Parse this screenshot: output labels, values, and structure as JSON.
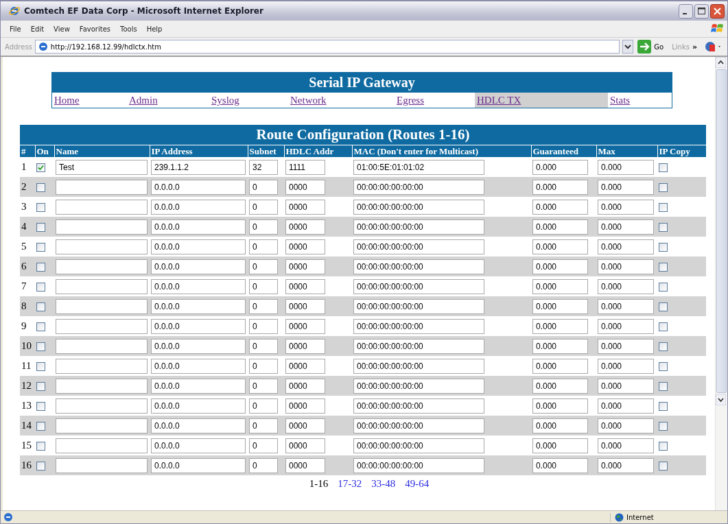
{
  "window": {
    "title": "Comtech EF Data Corp - Microsoft Internet Explorer"
  },
  "menu": [
    "File",
    "Edit",
    "View",
    "Favorites",
    "Tools",
    "Help"
  ],
  "address_bar": {
    "label": "Address",
    "value": "http://192.168.12.99/hdlctx.htm",
    "go": "Go",
    "links": "Links",
    "more": "»"
  },
  "nav": {
    "title": "Serial IP Gateway",
    "links": [
      {
        "label": "Home",
        "selected": false
      },
      {
        "label": "Admin",
        "selected": false
      },
      {
        "label": "Syslog",
        "selected": false
      },
      {
        "label": "Network",
        "selected": false
      },
      {
        "label": "Egress",
        "selected": false
      },
      {
        "label": "HDLC TX",
        "selected": true
      },
      {
        "label": "Stats",
        "selected": false
      }
    ]
  },
  "table": {
    "title": "Route Configuration (Routes 1-16)",
    "columns": [
      "#",
      "On",
      "Name",
      "IP Address",
      "Subnet",
      "HDLC Addr",
      "MAC (Don't enter for Multicast)",
      "Guaranteed",
      "Max",
      "IP Copy"
    ],
    "rows": [
      {
        "number": "1",
        "on": true,
        "name": "Test",
        "ip": "239.1.1.2",
        "subnet": "32",
        "hdlc": "1111",
        "mac": "01:00:5E:01:01:02",
        "guaranteed": "0.000",
        "max": "0.000",
        "ip_copy": false
      },
      {
        "number": "2",
        "on": false,
        "ip": "0.0.0.0",
        "subnet": "0",
        "hdlc": "0000",
        "mac": "00:00:00:00:00:00",
        "guaranteed": "0.000",
        "max": "0.000",
        "ip_copy": false
      },
      {
        "number": "3",
        "on": false,
        "ip": "0.0.0.0",
        "subnet": "0",
        "hdlc": "0000",
        "mac": "00:00:00:00:00:00",
        "guaranteed": "0.000",
        "max": "0.000",
        "ip_copy": false
      },
      {
        "number": "4",
        "on": false,
        "ip": "0.0.0.0",
        "subnet": "0",
        "hdlc": "0000",
        "mac": "00:00:00:00:00:00",
        "guaranteed": "0.000",
        "max": "0.000",
        "ip_copy": false
      },
      {
        "number": "5",
        "on": false,
        "ip": "0.0.0.0",
        "subnet": "0",
        "hdlc": "0000",
        "mac": "00:00:00:00:00:00",
        "guaranteed": "0.000",
        "max": "0.000",
        "ip_copy": false
      },
      {
        "number": "6",
        "on": false,
        "ip": "0.0.0.0",
        "subnet": "0",
        "hdlc": "0000",
        "mac": "00:00:00:00:00:00",
        "guaranteed": "0.000",
        "max": "0.000",
        "ip_copy": false
      },
      {
        "number": "7",
        "on": false,
        "ip": "0.0.0.0",
        "subnet": "0",
        "hdlc": "0000",
        "mac": "00:00:00:00:00:00",
        "guaranteed": "0.000",
        "max": "0.000",
        "ip_copy": false
      },
      {
        "number": "8",
        "on": false,
        "ip": "0.0.0.0",
        "subnet": "0",
        "hdlc": "0000",
        "mac": "00:00:00:00:00:00",
        "guaranteed": "0.000",
        "max": "0.000",
        "ip_copy": false
      },
      {
        "number": "9",
        "on": false,
        "ip": "0.0.0.0",
        "subnet": "0",
        "hdlc": "0000",
        "mac": "00:00:00:00:00:00",
        "guaranteed": "0.000",
        "max": "0.000",
        "ip_copy": false
      },
      {
        "number": "10",
        "on": false,
        "ip": "0.0.0.0",
        "subnet": "0",
        "hdlc": "0000",
        "mac": "00:00:00:00:00:00",
        "guaranteed": "0.000",
        "max": "0.000",
        "ip_copy": false
      },
      {
        "number": "11",
        "on": false,
        "ip": "0.0.0.0",
        "subnet": "0",
        "hdlc": "0000",
        "mac": "00:00:00:00:00:00",
        "guaranteed": "0.000",
        "max": "0.000",
        "ip_copy": false
      },
      {
        "number": "12",
        "on": false,
        "ip": "0.0.0.0",
        "subnet": "0",
        "hdlc": "0000",
        "mac": "00:00:00:00:00:00",
        "guaranteed": "0.000",
        "max": "0.000",
        "ip_copy": false
      },
      {
        "number": "13",
        "on": false,
        "ip": "0.0.0.0",
        "subnet": "0",
        "hdlc": "0000",
        "mac": "00:00:00:00:00:00",
        "guaranteed": "0.000",
        "max": "0.000",
        "ip_copy": false
      },
      {
        "number": "14",
        "on": false,
        "ip": "0.0.0.0",
        "subnet": "0",
        "hdlc": "0000",
        "mac": "00:00:00:00:00:00",
        "guaranteed": "0.000",
        "max": "0.000",
        "ip_copy": false
      },
      {
        "number": "15",
        "on": false,
        "ip": "0.0.0.0",
        "subnet": "0",
        "hdlc": "0000",
        "mac": "00:00:00:00:00:00",
        "guaranteed": "0.000",
        "max": "0.000",
        "ip_copy": false
      },
      {
        "number": "16",
        "on": false,
        "ip": "0.0.0.0",
        "subnet": "0",
        "hdlc": "0000",
        "mac": "00:00:00:00:00:00",
        "guaranteed": "0.000",
        "max": "0.000",
        "ip_copy": false
      }
    ]
  },
  "pagination": [
    {
      "label": "1-16",
      "selected": true
    },
    {
      "label": "17-32",
      "selected": false
    },
    {
      "label": "33-48",
      "selected": false
    },
    {
      "label": "49-64",
      "selected": false
    }
  ],
  "status_bar": {
    "zone": "Internet"
  }
}
